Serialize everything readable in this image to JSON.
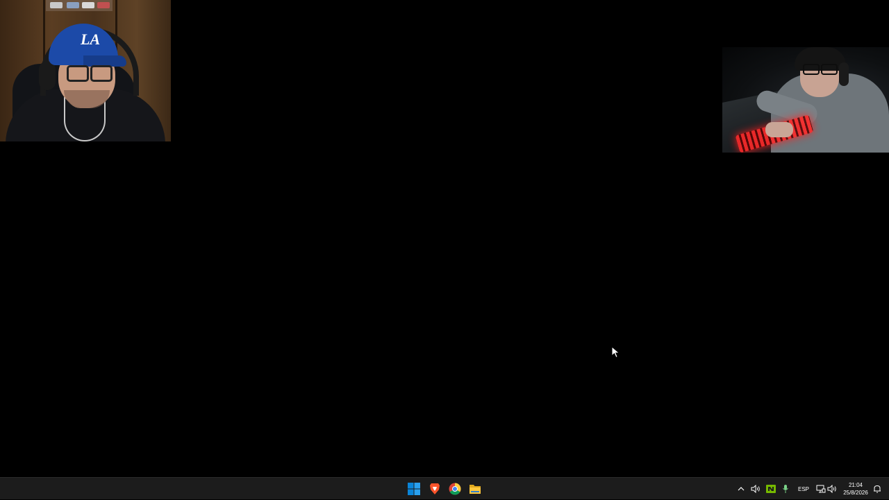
{
  "webcams": {
    "left_logo": "LA"
  },
  "taskbar": {
    "apps": [
      {
        "name": "start",
        "icon": "windows-icon"
      },
      {
        "name": "brave",
        "icon": "brave-icon"
      },
      {
        "name": "chrome",
        "icon": "chrome-icon"
      },
      {
        "name": "explorer",
        "icon": "folder-icon"
      }
    ],
    "tray": {
      "language": "ESP",
      "time": "21:04",
      "date": "25/8/2026"
    }
  },
  "colors": {
    "desktop": "#000000",
    "taskbar": "#1c1c1c",
    "windows_accent": "#0078d4",
    "brave": "#fb542b",
    "folder": "#ffc83d",
    "nvidia": "#76b900"
  }
}
